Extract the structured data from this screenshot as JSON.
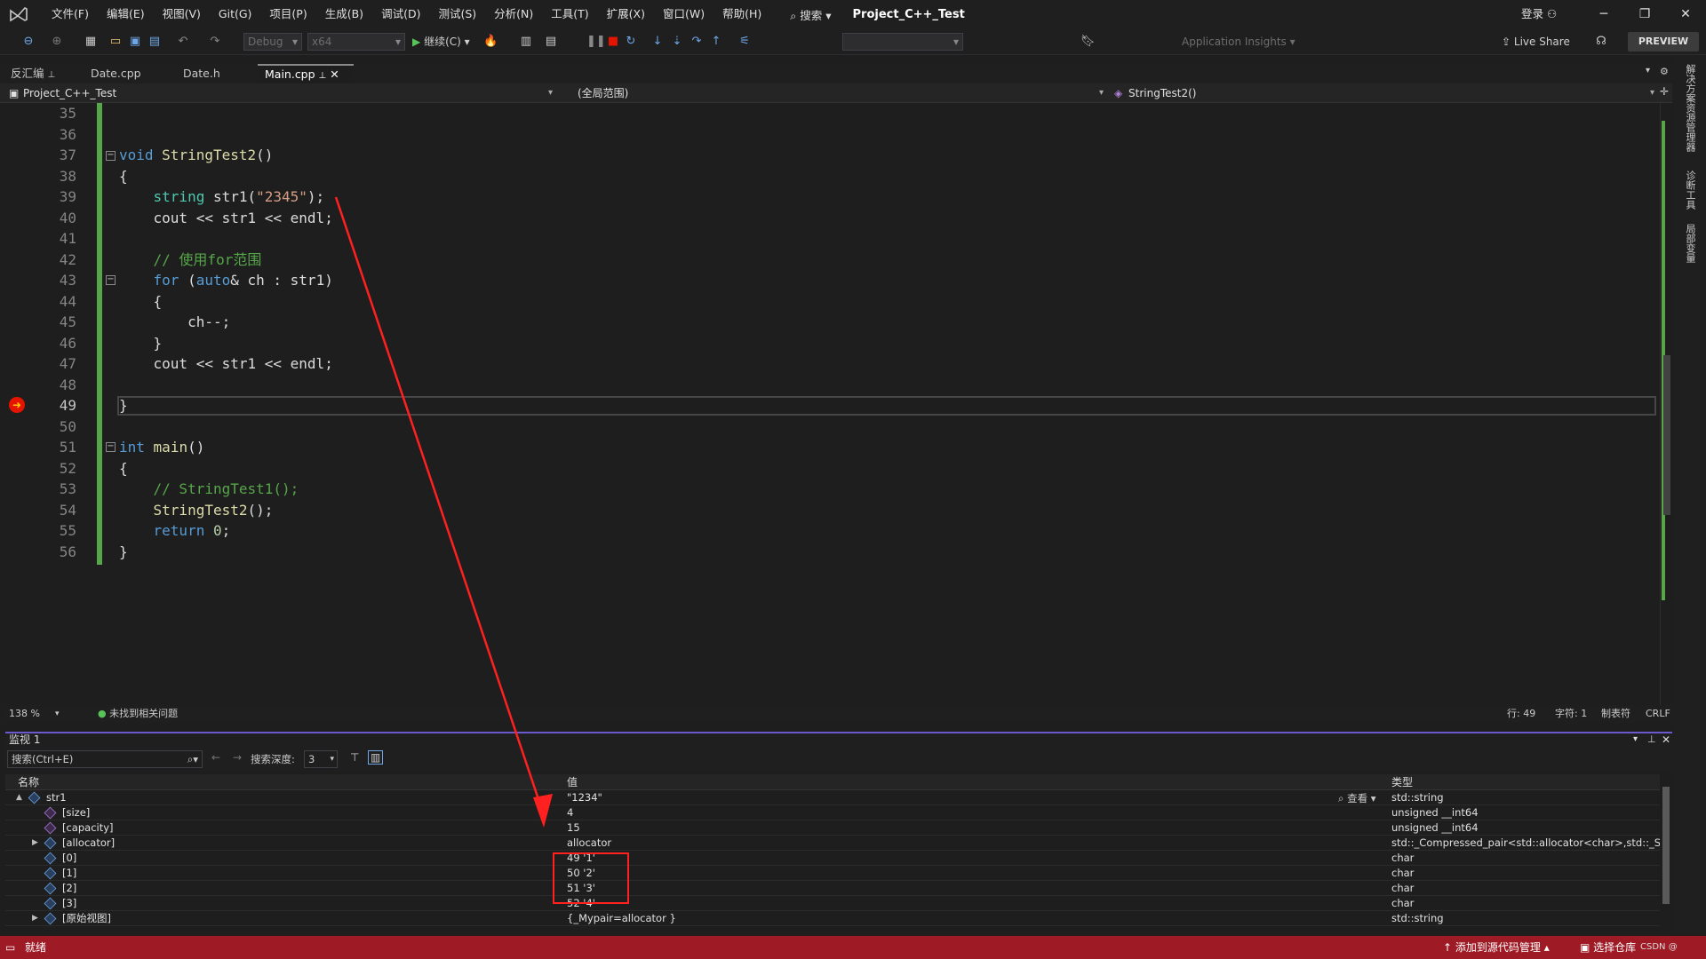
{
  "menubar": {
    "items": [
      "文件(F)",
      "编辑(E)",
      "视图(V)",
      "Git(G)",
      "项目(P)",
      "生成(B)",
      "调试(D)",
      "测试(S)",
      "分析(N)",
      "工具(T)",
      "扩展(X)",
      "窗口(W)",
      "帮助(H)"
    ],
    "search": "搜索",
    "project_title": "Project_C++_Test",
    "login": "登录"
  },
  "toolbar": {
    "config": "Debug",
    "platform": "x64",
    "continue": "继续(C)",
    "app_insights": "Application Insights",
    "live_share": "Live Share",
    "preview": "PREVIEW"
  },
  "tabs": {
    "disasm": "反汇编",
    "date_cpp": "Date.cpp",
    "date_h": "Date.h",
    "main_cpp": "Main.cpp"
  },
  "navbar": {
    "project": "Project_C++_Test",
    "scope": "(全局范围)",
    "function": "StringTest2()"
  },
  "editor": {
    "line_numbers": [
      "35",
      "36",
      "37",
      "38",
      "39",
      "40",
      "41",
      "42",
      "43",
      "44",
      "45",
      "46",
      "47",
      "48",
      "49",
      "50",
      "51",
      "52",
      "53",
      "54",
      "55",
      "56"
    ],
    "current_line": "49",
    "lines": [
      {
        "tokens": []
      },
      {
        "tokens": []
      },
      {
        "tokens": [
          {
            "t": "void",
            "c": "kw"
          },
          {
            "t": " "
          },
          {
            "t": "StringTest2",
            "c": "fn"
          },
          {
            "t": "()"
          }
        ]
      },
      {
        "tokens": [
          {
            "t": "{"
          }
        ]
      },
      {
        "tokens": [
          {
            "t": "    "
          },
          {
            "t": "string",
            "c": "ty"
          },
          {
            "t": " str1("
          },
          {
            "t": "\"2345\"",
            "c": "st"
          },
          {
            "t": ");"
          }
        ]
      },
      {
        "tokens": [
          {
            "t": "    cout << str1 << endl;"
          }
        ]
      },
      {
        "tokens": []
      },
      {
        "tokens": [
          {
            "t": "    "
          },
          {
            "t": "// 使用for范围",
            "c": "cm"
          }
        ]
      },
      {
        "tokens": [
          {
            "t": "    "
          },
          {
            "t": "for",
            "c": "kw"
          },
          {
            "t": " ("
          },
          {
            "t": "auto",
            "c": "kw"
          },
          {
            "t": "& ch : str1)"
          }
        ]
      },
      {
        "tokens": [
          {
            "t": "    {"
          }
        ]
      },
      {
        "tokens": [
          {
            "t": "        ch--;"
          }
        ]
      },
      {
        "tokens": [
          {
            "t": "    }"
          }
        ]
      },
      {
        "tokens": [
          {
            "t": "    cout << str1 << endl;"
          }
        ]
      },
      {
        "tokens": []
      },
      {
        "tokens": [
          {
            "t": "}"
          }
        ]
      },
      {
        "tokens": []
      },
      {
        "tokens": [
          {
            "t": "int",
            "c": "kw"
          },
          {
            "t": " "
          },
          {
            "t": "main",
            "c": "fn"
          },
          {
            "t": "()"
          }
        ]
      },
      {
        "tokens": [
          {
            "t": "{"
          }
        ]
      },
      {
        "tokens": [
          {
            "t": "    "
          },
          {
            "t": "// StringTest1();",
            "c": "cm"
          }
        ]
      },
      {
        "tokens": [
          {
            "t": "    "
          },
          {
            "t": "StringTest2",
            "c": "fn"
          },
          {
            "t": "();"
          }
        ]
      },
      {
        "tokens": [
          {
            "t": "    "
          },
          {
            "t": "return",
            "c": "kw"
          },
          {
            "t": " "
          },
          {
            "t": "0",
            "c": "nm"
          },
          {
            "t": ";"
          }
        ]
      },
      {
        "tokens": [
          {
            "t": "}"
          }
        ]
      }
    ]
  },
  "editor_status": {
    "zoom": "138 %",
    "issues": "未找到相关问题",
    "line": "行: 49",
    "char": "字符: 1",
    "tab": "制表符",
    "eol": "CRLF"
  },
  "watch": {
    "title": "监视 1",
    "search_placeholder": "搜索(Ctrl+E)",
    "depth_label": "搜索深度:",
    "depth": "3",
    "col_name": "名称",
    "col_value": "值",
    "col_type": "类型",
    "view_label": "查看",
    "rows": [
      {
        "name": "str1",
        "value": "\"1234\"",
        "type": "std::string",
        "expand": "▲"
      },
      {
        "name": "[size]",
        "value": "4",
        "type": "unsigned __int64",
        "expand": ""
      },
      {
        "name": "[capacity]",
        "value": "15",
        "type": "unsigned __int64",
        "expand": ""
      },
      {
        "name": "[allocator]",
        "value": "allocator",
        "type": "std::_Compressed_pair<std::allocator<char>,std::_String...",
        "expand": "▶"
      },
      {
        "name": "[0]",
        "value": "49 '1'",
        "type": "char",
        "expand": ""
      },
      {
        "name": "[1]",
        "value": "50 '2'",
        "type": "char",
        "expand": ""
      },
      {
        "name": "[2]",
        "value": "51 '3'",
        "type": "char",
        "expand": ""
      },
      {
        "name": "[3]",
        "value": "52 '4'",
        "type": "char",
        "expand": ""
      },
      {
        "name": "[原始视图]",
        "value": "{_Mypair=allocator }",
        "type": "std::string",
        "expand": "▶"
      }
    ]
  },
  "right_dock": [
    "解决方案资源管理器",
    "诊断工具",
    "局部变量"
  ],
  "statusbar": {
    "ready": "就绪",
    "add_source": "添加到源代码管理",
    "select_repo": "选择仓库",
    "watermark": "CSDN @"
  },
  "colors": {
    "accent_green": "#57a64a",
    "status_red": "#9e1a25",
    "annotation_red": "#ff2020"
  }
}
